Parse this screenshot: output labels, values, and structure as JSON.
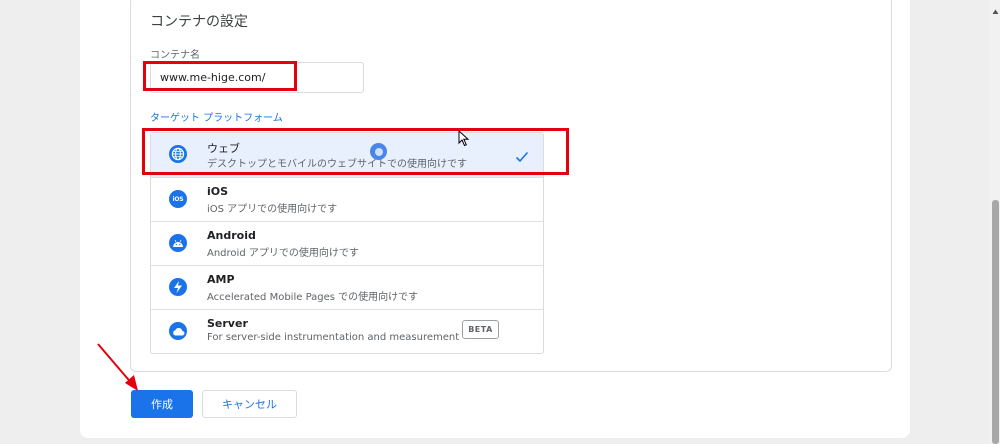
{
  "form": {
    "section_title": "コンテナの設定",
    "name_label": "コンテナ名",
    "name_value": "www.me-hige.com/",
    "platform_label": "ターゲット プラットフォーム"
  },
  "platforms": [
    {
      "name": "ウェブ",
      "desc": "デスクトップとモバイルのウェブサイトでの使用向けです",
      "icon": "globe-icon",
      "selected": true
    },
    {
      "name": "iOS",
      "desc": "iOS アプリでの使用向けです",
      "icon": "ios-icon",
      "icon_text": "iOS"
    },
    {
      "name": "Android",
      "desc": "Android アプリでの使用向けです",
      "icon": "android-icon"
    },
    {
      "name": "AMP",
      "desc": "Accelerated Mobile Pages での使用向けです",
      "icon": "amp-bolt-icon"
    },
    {
      "name": "Server",
      "desc": "For server-side instrumentation and measurement",
      "icon": "cloud-icon",
      "badge": "BETA"
    }
  ],
  "actions": {
    "create_label": "作成",
    "cancel_label": "キャンセル"
  },
  "colors": {
    "accent": "#1a73e8",
    "selected_bg": "#e8f0fe",
    "annotation_red": "#e3000f"
  }
}
